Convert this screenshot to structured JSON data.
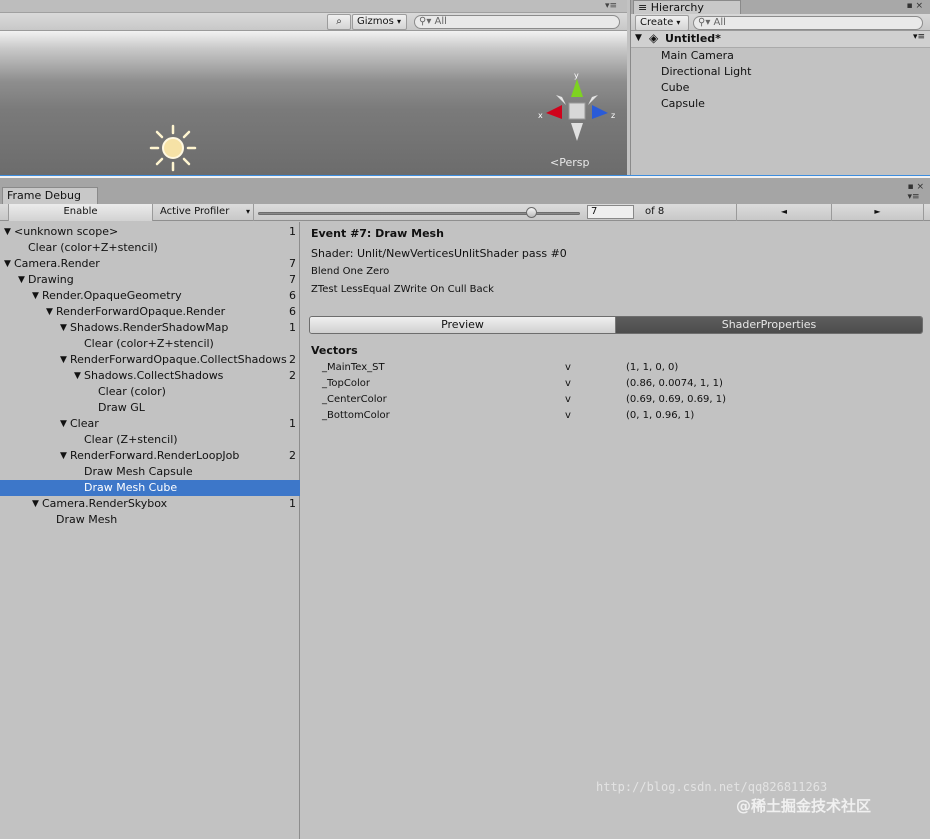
{
  "scene": {
    "gizmos_label": "Gizmos",
    "search_placeholder": "All",
    "persp_label": "Persp",
    "axis_x": "x",
    "axis_y": "y",
    "axis_z": "z"
  },
  "hierarchy": {
    "tab_label": "Hierarchy",
    "create_label": "Create",
    "search_placeholder": "All",
    "scene_name": "Untitled*",
    "items": [
      "Main Camera",
      "Directional Light",
      "Cube",
      "Capsule"
    ]
  },
  "frame_debug": {
    "tab_label": "Frame Debug",
    "enable_label": "Enable",
    "profiler_label": "Active Profiler",
    "event_index": "7",
    "of_label": "of 8",
    "prev_icon": "◄",
    "next_icon": "►",
    "tree": [
      {
        "label": "<unknown scope>",
        "count": "1",
        "arrow": true
      },
      {
        "label": "Clear (color+Z+stencil)",
        "count": "",
        "arrow": false
      },
      {
        "label": "Camera.Render",
        "count": "7",
        "arrow": true
      },
      {
        "label": "Drawing",
        "count": "7",
        "arrow": true
      },
      {
        "label": "Render.OpaqueGeometry",
        "count": "6",
        "arrow": true
      },
      {
        "label": "RenderForwardOpaque.Render",
        "count": "6",
        "arrow": true
      },
      {
        "label": "Shadows.RenderShadowMap",
        "count": "1",
        "arrow": true
      },
      {
        "label": "Clear (color+Z+stencil)",
        "count": "",
        "arrow": false
      },
      {
        "label": "RenderForwardOpaque.CollectShadows",
        "count": "2",
        "arrow": true
      },
      {
        "label": "Shadows.CollectShadows",
        "count": "2",
        "arrow": true
      },
      {
        "label": "Clear (color)",
        "count": "",
        "arrow": false
      },
      {
        "label": "Draw GL",
        "count": "",
        "arrow": false
      },
      {
        "label": "Clear",
        "count": "1",
        "arrow": true
      },
      {
        "label": "Clear (Z+stencil)",
        "count": "",
        "arrow": false
      },
      {
        "label": "RenderForward.RenderLoopJob",
        "count": "2",
        "arrow": true
      },
      {
        "label": "Draw Mesh Capsule",
        "count": "",
        "arrow": false
      },
      {
        "label": "Draw Mesh Cube",
        "count": "",
        "arrow": false,
        "selected": true
      },
      {
        "label": "Camera.RenderSkybox",
        "count": "1",
        "arrow": true
      },
      {
        "label": "Draw Mesh",
        "count": "",
        "arrow": false
      }
    ],
    "details": {
      "event_title": "Event #7: Draw Mesh",
      "shader_line": "Shader: Unlit/NewVerticesUnlitShader pass #0",
      "blend_line": "Blend One Zero",
      "ztest_line": "ZTest LessEqual ZWrite On Cull Back",
      "preview_tab": "Preview",
      "shaderprops_tab": "ShaderProperties",
      "vectors_heading": "Vectors",
      "vectors": [
        {
          "name": "_MainTex_ST",
          "type": "v",
          "value": "(1, 1, 0, 0)"
        },
        {
          "name": "_TopColor",
          "type": "v",
          "value": "(0.86, 0.0074, 1, 1)"
        },
        {
          "name": "_CenterColor",
          "type": "v",
          "value": "(0.69, 0.69, 0.69, 1)"
        },
        {
          "name": "_BottomColor",
          "type": "v",
          "value": "(0, 1, 0.96, 1)"
        }
      ]
    }
  },
  "watermark": {
    "url": "http://blog.csdn.net/qq826811263",
    "brand": "@稀土掘金技术社区"
  }
}
